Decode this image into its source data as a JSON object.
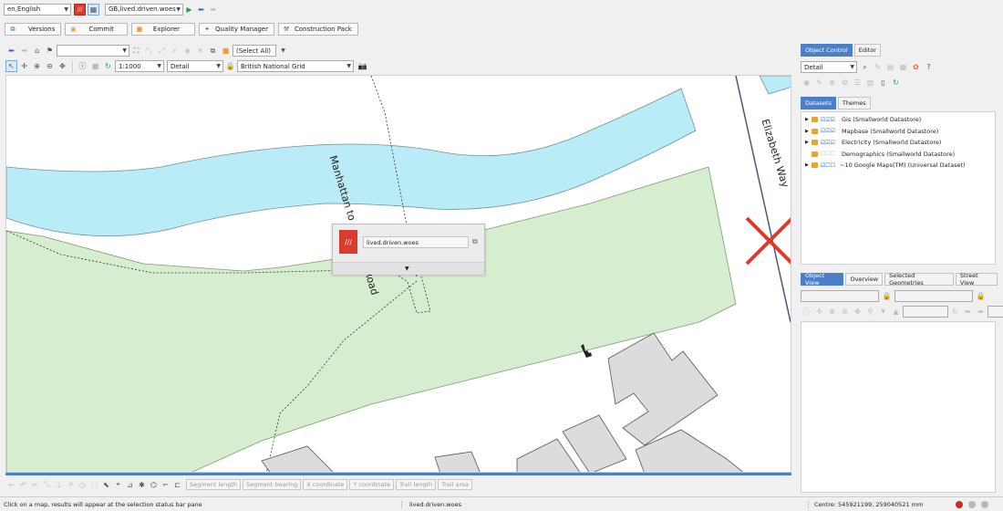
{
  "top": {
    "language": "en,English",
    "workspace": "GB,lived.driven.woes"
  },
  "actions": {
    "versions": "Versions",
    "commit": "Commit",
    "explorer": "Explorer",
    "quality": "Quality Manager",
    "construction": "Construction Pack"
  },
  "maptools": {
    "select_all": "(Select All)",
    "scale": "1:1000",
    "detail": "Detail",
    "crs": "British National Grid"
  },
  "map": {
    "road1": "Manhattan to Auckland Road",
    "road2": "Elizabeth Way",
    "popup_text": "lived.driven.woes"
  },
  "panel": {
    "tabs": [
      "Object Control",
      "Editor"
    ],
    "detail": "Detail",
    "dataset_tabs": [
      "Datasets",
      "Themes"
    ],
    "datasets": [
      {
        "marks": "☑☑☑",
        "name": "Gis (Smallworld Datastore)"
      },
      {
        "marks": "☑☑☑",
        "name": "Mapbase (Smallworld Datastore)"
      },
      {
        "marks": "☑☑☑",
        "name": "Electricity (Smallworld Datastore)"
      },
      {
        "marks": "☐☐☐",
        "name": "Demographics (Smallworld Datastore)"
      },
      {
        "marks": "☑☐☐",
        "name": "~10 Google Maps(TM) (Universal Dataset)"
      }
    ],
    "view_tabs": [
      "Object View",
      "Overview",
      "Selected Geometries",
      "Street View"
    ]
  },
  "editbar": {
    "segment_length": "Segment length",
    "segment_bearing": "Segment bearing",
    "x_coord": "X coordinate",
    "y_coord": "Y coordinate",
    "trail_length": "Trail length",
    "trail_area": "Trail area"
  },
  "status": {
    "hint": "Click on a map, results will appear at the selection status bar pane",
    "workspace": "lived.driven.woes",
    "centre": "Centre: 545921199, 259040521 mm"
  },
  "colors": {
    "water": "#b9ecf6",
    "park": "#d6edcf",
    "building": "#dcdcdf",
    "accent": "#4d7fc9",
    "marker": "#e03a2f"
  }
}
